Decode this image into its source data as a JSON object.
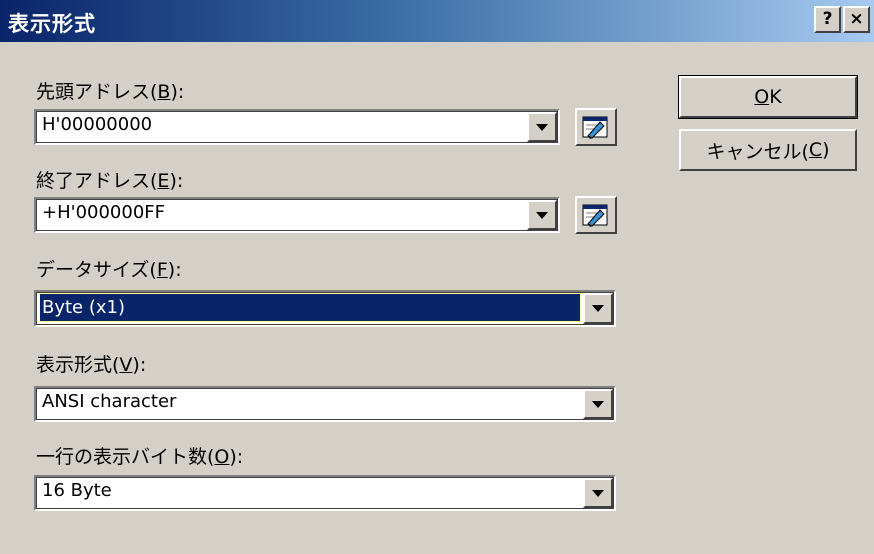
{
  "window": {
    "title": "表示形式",
    "help_label": "?",
    "close_label": "×"
  },
  "fields": {
    "start_address": {
      "label_prefix": "先頭アドレス(",
      "label_key": "B",
      "label_suffix": "):",
      "value": "H'00000000"
    },
    "end_address": {
      "label_prefix": "終了アドレス(",
      "label_key": "E",
      "label_suffix": "):",
      "value": "+H'000000FF"
    },
    "data_size": {
      "label_prefix": "データサイズ(",
      "label_key": "F",
      "label_suffix": "):",
      "value": "Byte (x1)"
    },
    "display_format": {
      "label_prefix": "表示形式(",
      "label_key": "V",
      "label_suffix": "):",
      "value": "ANSI character"
    },
    "bytes_per_line": {
      "label_prefix": "一行の表示バイト数(",
      "label_key": "O",
      "label_suffix": "):",
      "value": "16 Byte"
    }
  },
  "buttons": {
    "ok": {
      "label_key": "O",
      "label_suffix": "K"
    },
    "cancel": {
      "label_prefix": "キャンセル(",
      "label_key": "C",
      "label_suffix": ")"
    }
  },
  "icons": {
    "address_picker": "address-picker-icon"
  },
  "colors": {
    "face": "#d4d0c8",
    "title_start": "#0a246a",
    "title_end": "#a6caf0",
    "selection": "#0a246a"
  }
}
